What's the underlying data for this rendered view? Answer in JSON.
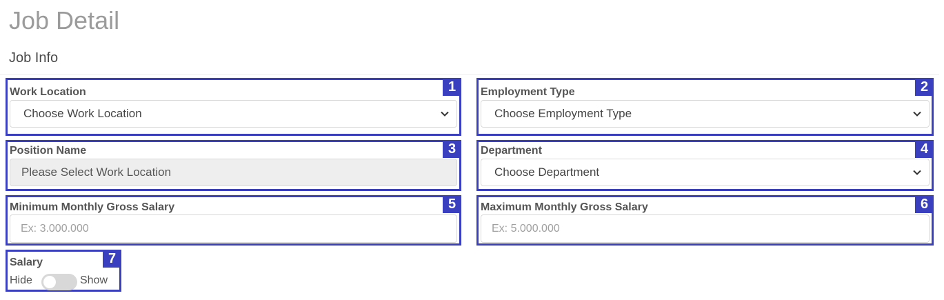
{
  "page": {
    "title": "Job Detail",
    "section": "Job Info"
  },
  "fields": {
    "work_location": {
      "badge": "1",
      "label": "Work Location",
      "value": "Choose Work Location",
      "icon": "chevron-down-icon"
    },
    "employment_type": {
      "badge": "2",
      "label": "Employment Type",
      "value": "Choose Employment Type",
      "icon": "chevron-down-icon"
    },
    "position_name": {
      "badge": "3",
      "label": "Position Name",
      "value": "Please Select Work Location"
    },
    "department": {
      "badge": "4",
      "label": "Department",
      "value": "Choose Department",
      "icon": "chevron-down-icon"
    },
    "min_salary": {
      "badge": "5",
      "label": "Minimum Monthly Gross Salary",
      "placeholder": "Ex: 3.000.000",
      "value": ""
    },
    "max_salary": {
      "badge": "6",
      "label": "Maximum Monthly Gross Salary",
      "placeholder": "Ex: 5.000.000",
      "value": ""
    },
    "salary": {
      "badge": "7",
      "label": "Salary",
      "off_label": "Hide",
      "on_label": "Show",
      "state": "off"
    }
  },
  "colors": {
    "annotation": "#3a3fbf",
    "title": "#9b9b9b",
    "disabled_bg": "#eeeeee"
  }
}
